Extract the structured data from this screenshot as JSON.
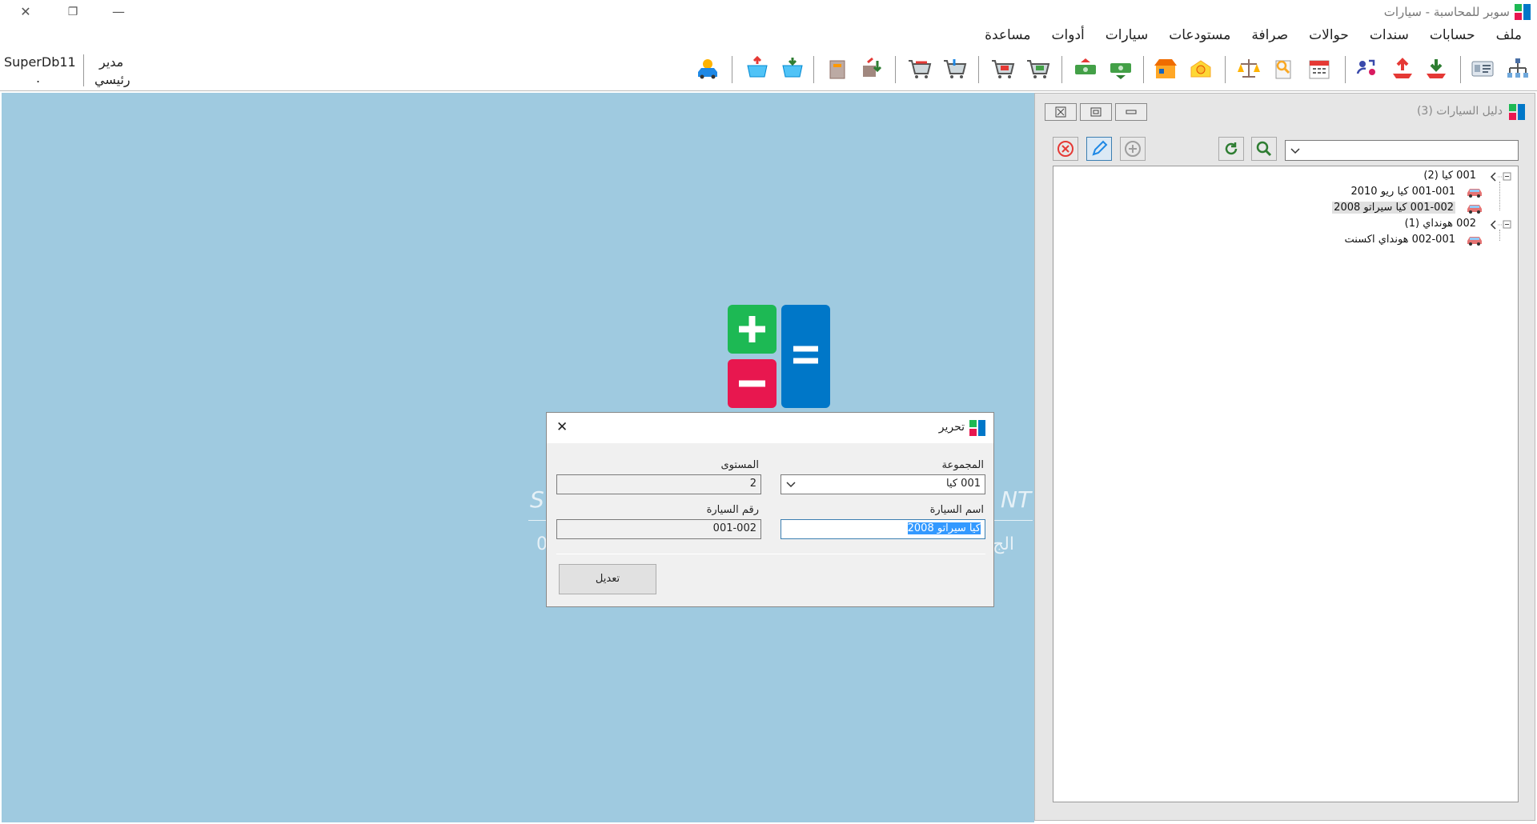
{
  "window": {
    "title": "سوبر للمحاسبة - سيارات",
    "controls": {
      "minimize": "—",
      "restore": "❐",
      "close": "✕"
    }
  },
  "menu": [
    "ملف",
    "حسابات",
    "سندات",
    "حوالات",
    "صرافة",
    "مستودعات",
    "سيارات",
    "أدوات",
    "مساعدة"
  ],
  "user": {
    "db_name": "SuperDb11",
    "db_sub": ".",
    "role_line1": "مدير",
    "role_line2": "رئيسي"
  },
  "toolbar_icons": [
    "org-chart-icon",
    "id-card-icon",
    "receive-arrow-icon",
    "send-arrow-icon",
    "transfer-users-icon",
    "calendar-icon",
    "search-doc-icon",
    "balance-scale-icon",
    "money-exchange-icon",
    "store-building-icon",
    "cash-down-icon",
    "cash-up-icon",
    "cart-in-icon",
    "cart-out-icon",
    "cart-return-icon",
    "cart-sale-icon",
    "cart-bill-icon",
    "cart-buy-icon",
    "box-move-icon",
    "box-icon",
    "basket-down-icon",
    "basket-up-icon",
    "car-user-icon"
  ],
  "dialog": {
    "title": "تحرير",
    "group_label": "المجموعة",
    "group_value": "001 كيا",
    "level_label": "المستوى",
    "level_value": "2",
    "car_name_label": "اسم السيارة",
    "car_name_value": "كيا سيراتو 2008",
    "car_number_label": "رقم السيارة",
    "car_number_value": "001-002",
    "submit_label": "تعديل",
    "close": "✕"
  },
  "panel": {
    "title": "دليل السيارات (3)",
    "search_value": "",
    "tree": [
      {
        "label": "001 كيا (2)",
        "level": 0
      },
      {
        "label": "001-001 كيا ريو 2010",
        "level": 1
      },
      {
        "label": "001-002 كيا سيراتو 2008",
        "level": 1,
        "selected": true
      },
      {
        "label": "002 هونداي (1)",
        "level": 0
      },
      {
        "label": "002-001 هونداي اكسنت",
        "level": 1
      }
    ]
  },
  "background_text": {
    "left_fragment": "S",
    "right_fragment": "NT",
    "left2": "0",
    "right2": "الج"
  },
  "colors": {
    "desktop": "#9fcae0",
    "logo_green": "#1db954",
    "logo_red": "#e8174f",
    "logo_blue": "#0077c8",
    "selection": "#3399ff"
  }
}
